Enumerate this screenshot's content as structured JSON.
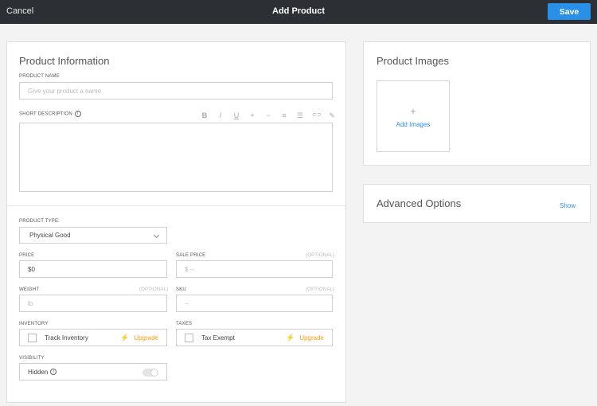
{
  "topbar": {
    "cancel_label": "Cancel",
    "title": "Add Product",
    "save_label": "Save"
  },
  "product_info": {
    "title": "Product Information",
    "name_label": "PRODUCT NAME",
    "name_placeholder": "Give your product a name",
    "short_desc_label": "SHORT DESCRIPTION",
    "toolbar": [
      "B",
      "I",
      "U",
      "+",
      "−",
      "≡",
      "☰",
      "⊂⊃",
      "✎"
    ],
    "product_type_label": "PRODUCT TYPE:",
    "product_type_value": "Physical Good",
    "price_label": "PRICE",
    "price_value": "$0",
    "sale_price_label": "SALE PRICE",
    "sale_price_optional": "(OPTIONAL)",
    "sale_price_placeholder": "$ --",
    "weight_label": "WEIGHT",
    "weight_optional": "(OPTIONAL)",
    "weight_placeholder": "lb",
    "sku_label": "SKU",
    "sku_optional": "(OPTIONAL)",
    "sku_placeholder": "--",
    "inventory_label": "INVENTORY",
    "inventory_option": "Track Inventory",
    "inventory_upgrade": "Upgrade",
    "taxes_label": "TAXES",
    "taxes_option": "Tax Exempt",
    "taxes_upgrade": "Upgrade",
    "visibility_label": "VISIBILITY",
    "visibility_value": "Hidden"
  },
  "product_images": {
    "title": "Product Images",
    "plus": "+",
    "add_label": "Add Images"
  },
  "advanced_options": {
    "title": "Advanced Options",
    "show_label": "Show"
  },
  "colors": {
    "accent": "#2a8fe6",
    "upgrade": "#f39c12",
    "topbar": "#2c2f33"
  }
}
